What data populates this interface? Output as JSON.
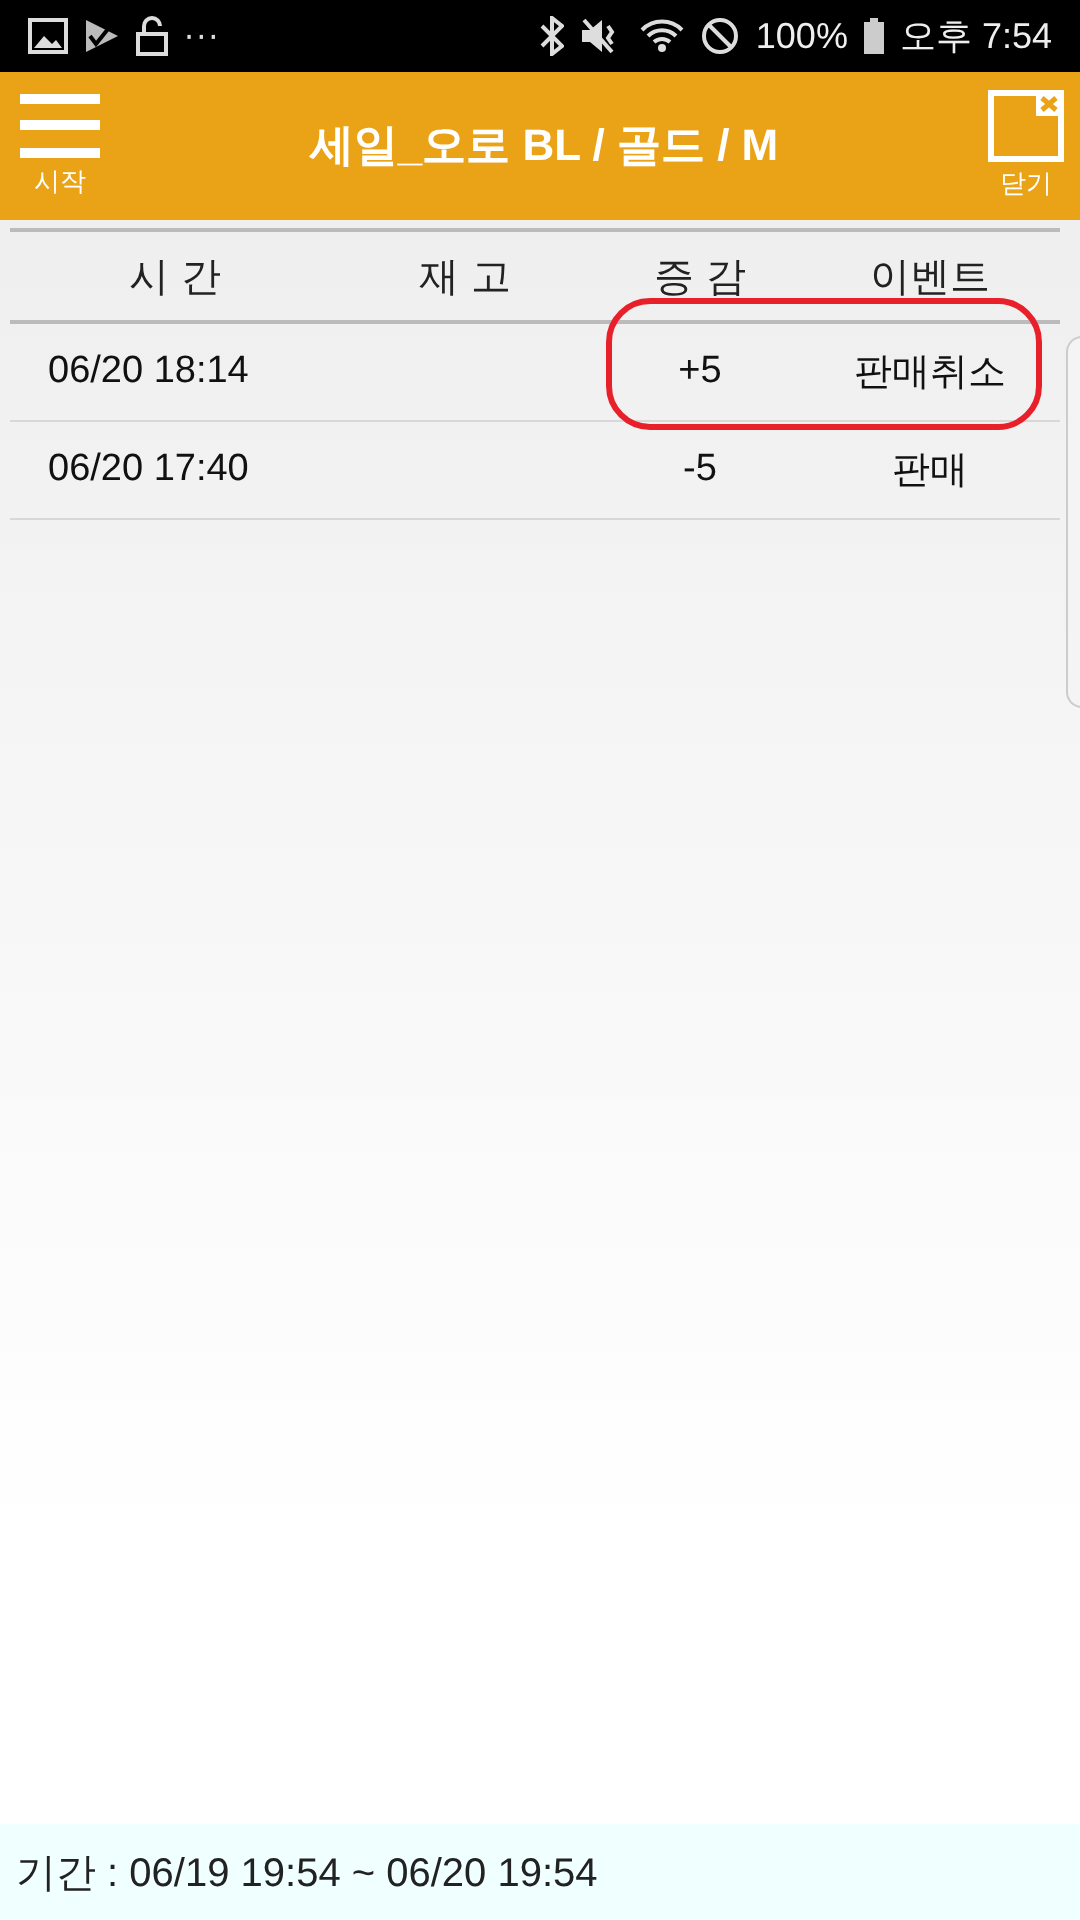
{
  "status_bar": {
    "battery_text": "100%",
    "time": "오후 7:54",
    "more": "···"
  },
  "header": {
    "menu_label": "시작",
    "title": "세일_오로 BL / 골드 / M",
    "close_label": "닫기"
  },
  "table": {
    "columns": [
      "시 간",
      "재 고",
      "증 감",
      "이벤트"
    ],
    "rows": [
      {
        "time": "06/20 18:14",
        "change": "+5",
        "event": "판매취소",
        "highlighted": true
      },
      {
        "time": "06/20 17:40",
        "change": "-5",
        "event": "판매",
        "highlighted": false
      }
    ]
  },
  "footer": {
    "period": "기간 : 06/19 19:54 ~ 06/20 19:54"
  }
}
